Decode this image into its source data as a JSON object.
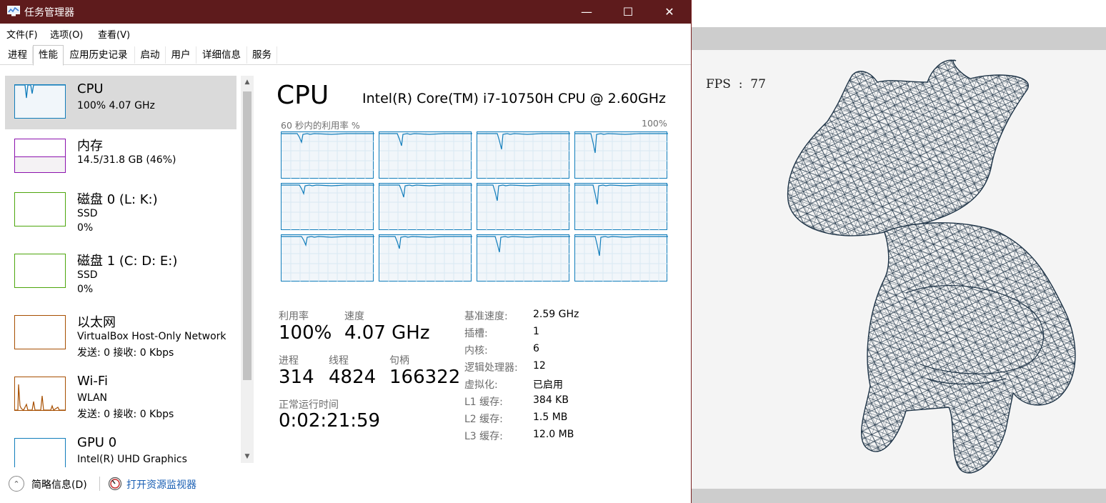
{
  "window": {
    "title": "任务管理器",
    "minimize_glyph": "—",
    "maximize_glyph": "☐",
    "close_glyph": "✕"
  },
  "menu": [
    "文件(F)",
    "选项(O)",
    "查看(V)"
  ],
  "tabs": [
    "进程",
    "性能",
    "应用历史记录",
    "启动",
    "用户",
    "详细信息",
    "服务"
  ],
  "active_tab": "性能",
  "sidebar": {
    "items": [
      {
        "name": "CPU",
        "sub1": "100% 4.07 GHz",
        "sub2": "",
        "color": "#117dbb"
      },
      {
        "name": "内存",
        "sub1": "14.5/31.8 GB (46%)",
        "sub2": "",
        "color": "#8b12ae"
      },
      {
        "name": "磁盘 0 (L: K:)",
        "sub1": "SSD",
        "sub2": "0%",
        "color": "#4da60c"
      },
      {
        "name": "磁盘 1 (C: D: E:)",
        "sub1": "SSD",
        "sub2": "0%",
        "color": "#4da60c"
      },
      {
        "name": "以太网",
        "sub1": "VirtualBox Host-Only Network",
        "sub2": "发送: 0 接收: 0 Kbps",
        "color": "#a74f01"
      },
      {
        "name": "Wi-Fi",
        "sub1": "WLAN",
        "sub2": "发送: 0 接收: 0 Kbps",
        "color": "#a74f01"
      },
      {
        "name": "GPU 0",
        "sub1": "Intel(R) UHD Graphics",
        "sub2": "",
        "color": "#117dbb"
      }
    ],
    "memory_usage_fraction": 0.46
  },
  "cpu": {
    "title": "CPU",
    "model": "Intel(R) Core(TM) i7-10750H CPU @ 2.60GHz",
    "graph_label": "60 秒内的利用率 %",
    "graph_max": "100%",
    "logical_graph_count": 12,
    "utilization_label": "利用率",
    "utilization": "100%",
    "speed_label": "速度",
    "speed": "4.07 GHz",
    "processes_label": "进程",
    "processes": "314",
    "threads_label": "线程",
    "threads": "4824",
    "handles_label": "句柄",
    "handles": "166322",
    "uptime_label": "正常运行时间",
    "uptime": "0:02:21:59",
    "details": [
      {
        "label": "基准速度:",
        "value": "2.59 GHz"
      },
      {
        "label": "插槽:",
        "value": "1"
      },
      {
        "label": "内核:",
        "value": "6"
      },
      {
        "label": "逻辑处理器:",
        "value": "12"
      },
      {
        "label": "虚拟化:",
        "value": "已启用"
      },
      {
        "label": "L1 缓存:",
        "value": "384 KB"
      },
      {
        "label": "L2 缓存:",
        "value": "1.5 MB"
      },
      {
        "label": "L3 缓存:",
        "value": "12.0 MB"
      }
    ],
    "accent": "#117dbb"
  },
  "footer": {
    "fewer_details": "简略信息(D)",
    "open_monitor": "打开资源监视器"
  },
  "viewer": {
    "fps_label": "FPS",
    "fps_separator": ":",
    "fps_value": "77",
    "wire_color": "#1f3447"
  }
}
